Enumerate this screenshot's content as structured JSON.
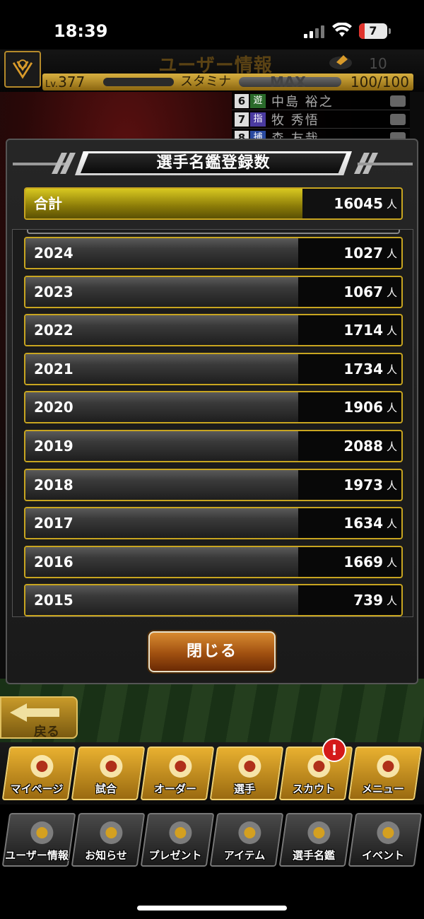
{
  "status_bar": {
    "time": "18:39",
    "battery": "7"
  },
  "header": {
    "title": "ユーザー情報",
    "coins": "10",
    "level_prefix": "Lv.",
    "level": "377",
    "stamina_label": "スタミナ",
    "stamina_max": "MAX",
    "stamina_value": "100/100"
  },
  "order_list": [
    {
      "num": "6",
      "pos": "遊",
      "name": "中島 裕之",
      "pos_color": "#2a6a2a"
    },
    {
      "num": "7",
      "pos": "指",
      "name": "牧 秀悟",
      "pos_color": "#4a3aa0"
    },
    {
      "num": "8",
      "pos": "捕",
      "name": "森 友哉",
      "pos_color": "#2a4aa0"
    }
  ],
  "modal": {
    "title": "選手名鑑登録数",
    "total": {
      "label": "合計",
      "value": "16045",
      "unit": "人"
    },
    "rows": [
      {
        "year": "2024",
        "value": "1027",
        "unit": "人"
      },
      {
        "year": "2023",
        "value": "1067",
        "unit": "人"
      },
      {
        "year": "2022",
        "value": "1714",
        "unit": "人"
      },
      {
        "year": "2021",
        "value": "1734",
        "unit": "人"
      },
      {
        "year": "2020",
        "value": "1906",
        "unit": "人"
      },
      {
        "year": "2019",
        "value": "2088",
        "unit": "人"
      },
      {
        "year": "2018",
        "value": "1973",
        "unit": "人"
      },
      {
        "year": "2017",
        "value": "1634",
        "unit": "人"
      },
      {
        "year": "2016",
        "value": "1669",
        "unit": "人"
      },
      {
        "year": "2015",
        "value": "739",
        "unit": "人"
      }
    ],
    "close_label": "閉じる"
  },
  "back_label": "戻る",
  "nav_primary": [
    {
      "label": "マイページ",
      "icon": "mypage-icon"
    },
    {
      "label": "試合",
      "icon": "stadium-icon"
    },
    {
      "label": "オーダー",
      "icon": "field-order-icon"
    },
    {
      "label": "選手",
      "icon": "player-icon"
    },
    {
      "label": "スカウト",
      "icon": "scout-icon"
    },
    {
      "label": "メニュー",
      "icon": "menu-icon"
    }
  ],
  "nav_secondary": [
    {
      "label": "ユーザー情報",
      "icon": "user-info-icon"
    },
    {
      "label": "お知らせ",
      "icon": "notice-icon"
    },
    {
      "label": "プレゼント",
      "icon": "gift-icon"
    },
    {
      "label": "アイテム",
      "icon": "item-icon"
    },
    {
      "label": "選手名鑑",
      "icon": "player-book-icon"
    },
    {
      "label": "イベント",
      "icon": "event-icon"
    }
  ],
  "scout_alert": "!",
  "colors": {
    "gold_border": "#c8a520",
    "accent_orange": "#d88a30",
    "total_yellow": "#d8c820"
  }
}
